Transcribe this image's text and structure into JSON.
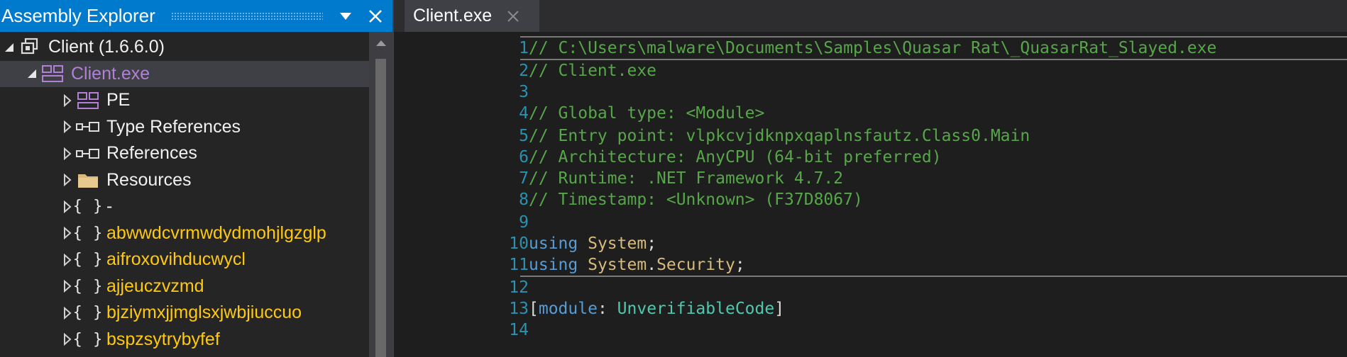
{
  "explorer": {
    "title": "Assembly Explorer",
    "dropdown_icon": "chevron-down-icon",
    "close_icon": "close-icon"
  },
  "tree": [
    {
      "name": "tree-item-client",
      "label": "Client (1.6.6.0)",
      "icon": "assembly-icon",
      "arrow": "expanded",
      "style": "default"
    },
    {
      "name": "tree-item-client-exe",
      "label": "Client.exe",
      "icon": "module-icon",
      "arrow": "expanded",
      "style": "purple",
      "selected": true
    },
    {
      "name": "tree-item-pe",
      "label": "PE",
      "icon": "module-icon",
      "arrow": "collapsed",
      "style": "default"
    },
    {
      "name": "tree-item-type-references",
      "label": "Type References",
      "icon": "reference-icon",
      "arrow": "collapsed",
      "style": "default"
    },
    {
      "name": "tree-item-references",
      "label": "References",
      "icon": "reference-icon",
      "arrow": "collapsed",
      "style": "default"
    },
    {
      "name": "tree-item-resources",
      "label": "Resources",
      "icon": "folder-icon",
      "arrow": "collapsed",
      "style": "default"
    },
    {
      "name": "tree-item-namespace-dash",
      "label": "-",
      "icon": "namespace-icon",
      "arrow": "collapsed",
      "style": "default"
    },
    {
      "name": "tree-item-namespace",
      "label": "abwwdcvrmwdydmohjlgzglp",
      "icon": "namespace-icon",
      "arrow": "collapsed",
      "style": "ns"
    },
    {
      "name": "tree-item-namespace",
      "label": "aifroxovihducwycl",
      "icon": "namespace-icon",
      "arrow": "collapsed",
      "style": "ns"
    },
    {
      "name": "tree-item-namespace",
      "label": "ajjeuczvzmd",
      "icon": "namespace-icon",
      "arrow": "collapsed",
      "style": "ns"
    },
    {
      "name": "tree-item-namespace",
      "label": "bjziymxjjmglsxjwbjiuccuo",
      "icon": "namespace-icon",
      "arrow": "collapsed",
      "style": "ns"
    },
    {
      "name": "tree-item-namespace",
      "label": "bspzsytrybyfef",
      "icon": "namespace-icon",
      "arrow": "collapsed",
      "style": "ns"
    }
  ],
  "tabs": [
    {
      "label": "Client.exe",
      "close_icon": "close-icon"
    }
  ],
  "editor": {
    "lines": [
      {
        "n": "1",
        "state": "current",
        "segments": [
          {
            "t": "// C:\\Users\\malware\\Documents\\Samples\\Quasar Rat\\_QuasarRat_Slayed.exe",
            "c": "comment"
          }
        ]
      },
      {
        "n": "2",
        "segments": [
          {
            "t": "// Client.exe",
            "c": "comment"
          }
        ]
      },
      {
        "n": "3",
        "segments": []
      },
      {
        "n": "4",
        "segments": [
          {
            "t": "// Global type: <Module>",
            "c": "comment"
          }
        ]
      },
      {
        "n": "5",
        "segments": [
          {
            "t": "// Entry point: vlpkcvjdknpxqaplnsfautz.Class0.Main",
            "c": "comment"
          }
        ]
      },
      {
        "n": "6",
        "segments": [
          {
            "t": "// Architecture: AnyCPU (64-bit preferred)",
            "c": "comment"
          }
        ]
      },
      {
        "n": "7",
        "segments": [
          {
            "t": "// Runtime: .NET Framework 4.7.2",
            "c": "comment"
          }
        ]
      },
      {
        "n": "8",
        "segments": [
          {
            "t": "// Timestamp: <Unknown> (F37D8067)",
            "c": "comment"
          }
        ]
      },
      {
        "n": "9",
        "segments": []
      },
      {
        "n": "10",
        "segments": [
          {
            "t": "using",
            "c": "key"
          },
          {
            "t": " ",
            "c": "punc"
          },
          {
            "t": "System",
            "c": "type"
          },
          {
            "t": ";",
            "c": "punc"
          }
        ]
      },
      {
        "n": "11",
        "state": "caretline",
        "segments": [
          {
            "t": "using",
            "c": "key"
          },
          {
            "t": " ",
            "c": "punc"
          },
          {
            "t": "System",
            "c": "type"
          },
          {
            "t": ".",
            "c": "punc"
          },
          {
            "t": "Security",
            "c": "type"
          },
          {
            "t": ";",
            "c": "punc"
          }
        ]
      },
      {
        "n": "12",
        "segments": []
      },
      {
        "n": "13",
        "segments": [
          {
            "t": "[",
            "c": "punc"
          },
          {
            "t": "module",
            "c": "key"
          },
          {
            "t": ": ",
            "c": "punc"
          },
          {
            "t": "UnverifiableCode",
            "c": "attr"
          },
          {
            "t": "]",
            "c": "punc"
          }
        ]
      },
      {
        "n": "14",
        "segments": []
      }
    ]
  },
  "colors": {
    "accent": "#007acc",
    "comment": "#57a64a",
    "keyword": "#569cd6",
    "type": "#d7ba7d",
    "attribute": "#4ec9b0",
    "line_number": "#2b91af",
    "namespace": "#ffc90e",
    "selected_module": "#b180d7"
  }
}
